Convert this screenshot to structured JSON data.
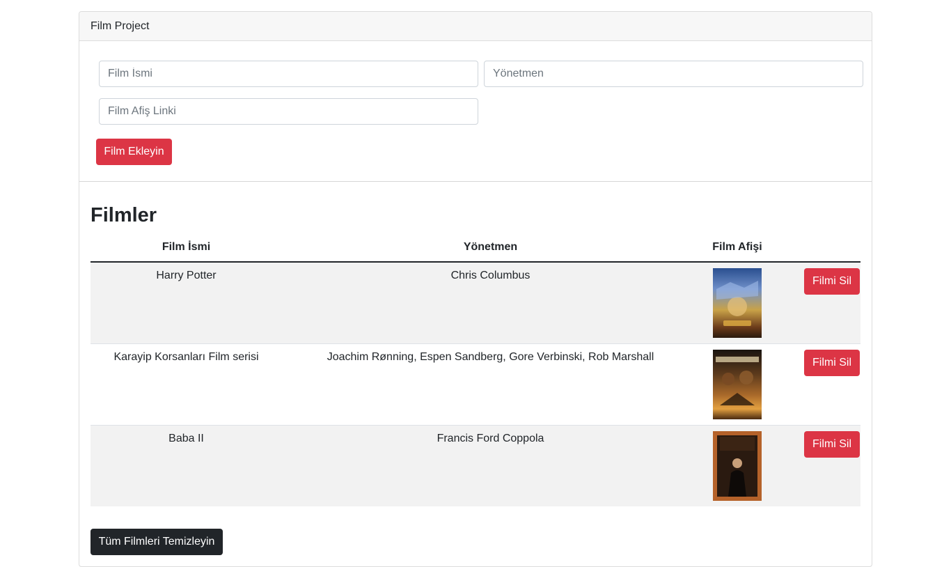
{
  "card": {
    "title": "Film Project"
  },
  "form": {
    "film_name_placeholder": "Film İsmi",
    "director_placeholder": "Yönetmen",
    "poster_link_placeholder": "Film Afiş Linki",
    "submit_label": "Film Ekleyin"
  },
  "list": {
    "heading": "Filmler",
    "columns": [
      "Film İsmi",
      "Yönetmen",
      "Film Afişi"
    ],
    "rows": [
      {
        "name": "Harry Potter",
        "director": "Chris Columbus",
        "delete_label": "Filmi Sil"
      },
      {
        "name": "Karayip Korsanları Film serisi",
        "director": "Joachim Rønning, Espen Sandberg, Gore Verbinski, Rob Marshall",
        "delete_label": "Filmi Sil"
      },
      {
        "name": "Baba II",
        "director": "Francis Ford Coppola",
        "delete_label": "Filmi Sil"
      }
    ],
    "clear_all_label": "Tüm Filmleri Temizleyin"
  },
  "colors": {
    "danger": "#dc3545",
    "dark": "#212529",
    "stripe": "#f2f2f2"
  }
}
